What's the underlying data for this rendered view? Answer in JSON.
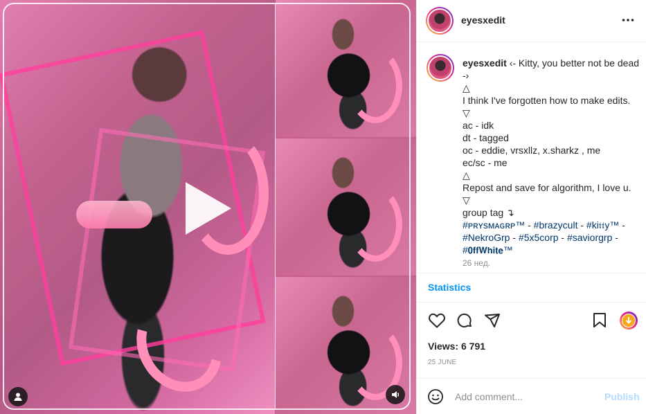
{
  "post": {
    "username": "eyesxedit",
    "caption_lines": [
      "‹- Kitty, you better not be dead -›",
      "△",
      "I think I've forgotten how to make edits.",
      "▽",
      "ac - idk",
      "dt - tagged",
      "oc - eddie, vrsxllz, x.sharkz , me",
      "ec/sc - me",
      "△",
      "Repost and save for algorithm, I love u.",
      "▽",
      "group tag ↴"
    ],
    "tags": [
      "#ᴘʀʏsᴍᴀɢʀᴘ™",
      "#brazycult",
      "#ki𝔱𝔱y™",
      "#NekroGrp",
      "#5x5corp",
      "#saviorgrp",
      "#𝟬𝗳𝗳𝗪𝗵𝗶𝘁𝗲™"
    ],
    "tag_separator": " - ",
    "caption_age": "26 нед.",
    "statistics_label": "Statistics",
    "views": "Views: 6 791",
    "date": "25 JUNE",
    "comment_placeholder": "Add comment...",
    "publish_label": "Publish"
  },
  "icons": {
    "more": "more-options-icon",
    "like": "heart-icon",
    "comment": "comment-icon",
    "share": "share-icon",
    "save": "bookmark-icon",
    "download": "download-icon",
    "emoji": "emoji-icon",
    "play": "play-icon",
    "user": "user-tag-icon",
    "sound": "speaker-icon"
  },
  "colors": {
    "accent": "#0095f6",
    "tag": "#00376b",
    "publish_disabled": "#b3dbff",
    "media_pink": "#ff3f9c"
  }
}
